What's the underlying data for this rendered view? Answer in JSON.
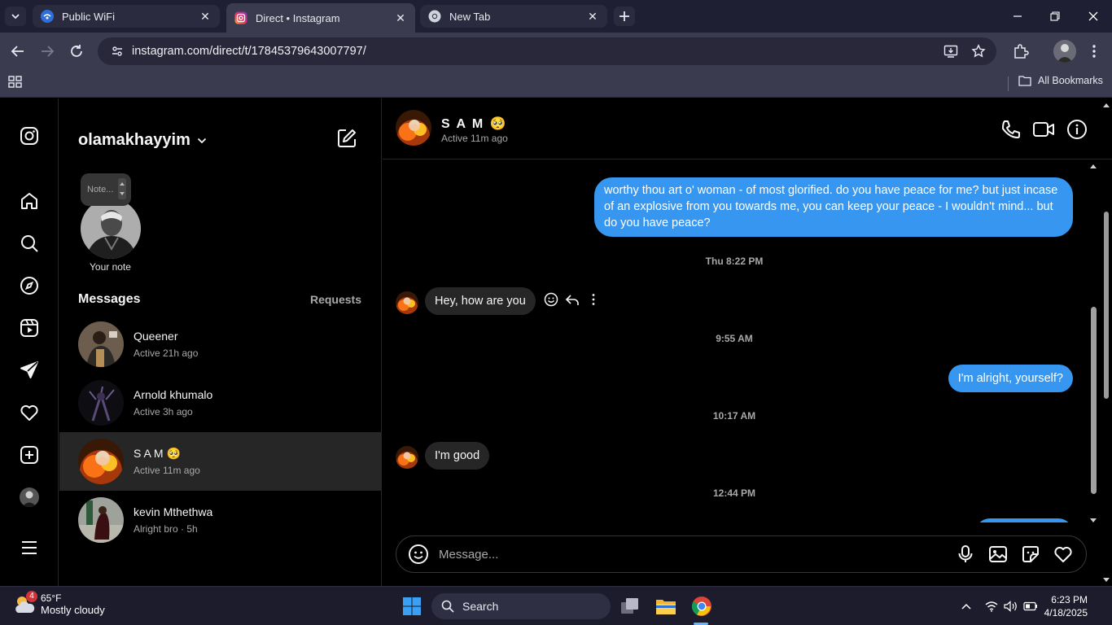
{
  "browser": {
    "tabs": [
      {
        "label": "Public WiFi"
      },
      {
        "label": "Direct • Instagram"
      },
      {
        "label": "New Tab"
      }
    ],
    "url": "instagram.com/direct/t/17845379643007797/",
    "bookmarks_label": "All Bookmarks"
  },
  "nav": {
    "items": [
      "instagram-logo",
      "home",
      "search",
      "explore",
      "reels",
      "messages",
      "notifications",
      "create",
      "profile",
      "more"
    ]
  },
  "inbox": {
    "account": "olamakhayyim",
    "note_placeholder": "Note...",
    "note_caption": "Your note",
    "messages_title": "Messages",
    "requests_label": "Requests",
    "conversations": [
      {
        "name": "Queener",
        "status": "Active 21h ago"
      },
      {
        "name": "Arnold khumalo",
        "status": "Active 3h ago"
      },
      {
        "name": "S A M 🥺",
        "status": "Active 11m ago"
      },
      {
        "name": "kevin Mthethwa",
        "status": "Alright bro · 5h"
      }
    ]
  },
  "chat": {
    "name": "S A M 🥺",
    "status": "Active 11m ago",
    "messages": [
      {
        "from": "me",
        "text": "worthy thou art o' woman - of most glorified. do you have peace for me? but just incase of an explosive from you towards me, you can keep your peace - I wouldn't mind... but do you have peace?"
      },
      {
        "timestamp": "Thu 8:22 PM"
      },
      {
        "from": "them",
        "text": "Hey, how are you"
      },
      {
        "timestamp": "9:55 AM"
      },
      {
        "from": "me",
        "text": "I'm alright, yourself?"
      },
      {
        "timestamp": "10:17 AM"
      },
      {
        "from": "them",
        "text": "I'm good"
      },
      {
        "timestamp": "12:44 PM"
      }
    ],
    "composer_placeholder": "Message..."
  },
  "taskbar": {
    "weather_badge": "4",
    "temperature": "65°F",
    "condition": "Mostly cloudy",
    "search_label": "Search",
    "time": "6:23 PM",
    "date": "4/18/2025"
  },
  "colors": {
    "accent_blue": "#3797f0",
    "incoming_bubble": "#262626",
    "background": "#000000"
  }
}
